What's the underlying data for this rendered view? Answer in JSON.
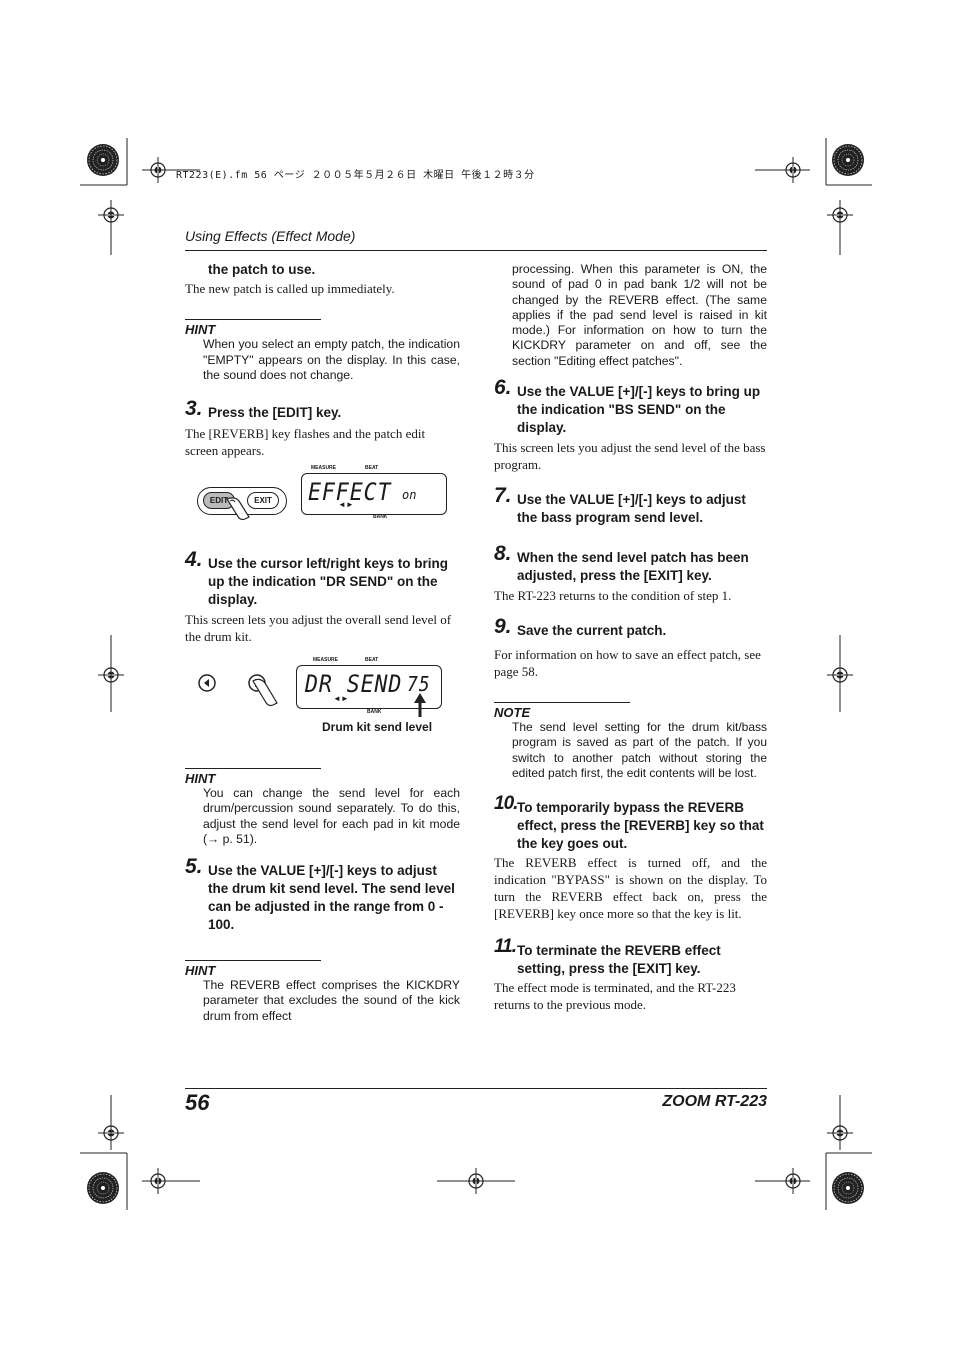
{
  "print_header": "RT223(E).fm  56 ページ  ２００５年５月２６日  木曜日  午後１２時３分",
  "running_head": "Using Effects (Effect Mode)",
  "footer": {
    "page_number": "56",
    "product": "ZOOM RT-223"
  },
  "left_column": {
    "intro_bold": "the patch to use.",
    "intro_body": "The new patch is called up immediately.",
    "hint1": {
      "label": "HINT",
      "text": "When you select an empty patch, the indication \"EMPTY\" appears on the display. In this case, the sound does not change."
    },
    "step3": {
      "number": "3.",
      "title": "Press the [EDIT] key.",
      "body": "The [REVERB] key flashes and the patch edit screen appears."
    },
    "figure1": {
      "edit_button": "EDIT",
      "exit_button": "EXIT",
      "measure_label": "MEASURE",
      "beat_label": "BEAT",
      "bank_label": "BANK",
      "lcd_main": "EFFECT",
      "lcd_value": "on"
    },
    "step4": {
      "number": "4.",
      "title": "Use the cursor left/right keys to bring up the indication \"DR SEND\" on the display.",
      "body": "This screen lets you adjust the overall send level of the drum kit."
    },
    "figure2": {
      "measure_label": "MEASURE",
      "beat_label": "BEAT",
      "bank_label": "BANK",
      "lcd_main": "DR SEND",
      "lcd_value": "75",
      "caption": "Drum kit send level"
    },
    "hint2": {
      "label": "HINT",
      "text": "You can change the send level for each drum/percussion sound separately. To do this, adjust the send level for each pad in kit mode (→ p. 51)."
    },
    "step5": {
      "number": "5.",
      "title": "Use the VALUE [+]/[-] keys to adjust the drum kit send level. The send level can be adjusted in the range from 0 - 100."
    },
    "hint3": {
      "label": "HINT",
      "text": "The REVERB effect comprises the KICKDRY parameter that excludes the sound of the kick drum from effect"
    }
  },
  "right_column": {
    "hint3_cont": "processing. When this parameter is ON, the sound of pad 0 in pad bank 1/2 will not be changed by the REVERB effect. (The same applies if the pad send level is raised in kit mode.) For information on how to turn the KICKDRY parameter on and off, see the section \"Editing effect patches\".",
    "step6": {
      "number": "6.",
      "title": "Use the VALUE [+]/[-] keys to bring up the indication \"BS SEND\" on the display.",
      "body": "This screen lets you adjust the send level of the bass program."
    },
    "step7": {
      "number": "7.",
      "title": "Use the VALUE [+]/[-] keys to adjust the bass program send level."
    },
    "step8": {
      "number": "8.",
      "title": "When the send level patch has been adjusted, press the [EXIT] key.",
      "body": "The RT-223 returns to the condition of step 1."
    },
    "step9": {
      "number": "9.",
      "title": "Save the current patch.",
      "body": "For information on how to save an effect patch, see page 58."
    },
    "note": {
      "label": "NOTE",
      "text": "The send level setting for the drum kit/bass program is saved as part of the patch. If you switch to another patch without storing the edited patch first, the edit contents will be lost."
    },
    "step10": {
      "number": "10.",
      "title": "To temporarily bypass the REVERB effect, press the [REVERB] key so that the key goes out.",
      "body": "The REVERB effect is turned off, and the indication \"BYPASS\" is shown on the display. To turn the REVERB effect back on, press the [REVERB] key once more so that the key is lit."
    },
    "step11": {
      "number": "11.",
      "title": "To terminate the REVERB effect setting, press the [EXIT] key.",
      "body": "The effect mode is terminated, and the RT-223 returns to the previous mode."
    }
  }
}
